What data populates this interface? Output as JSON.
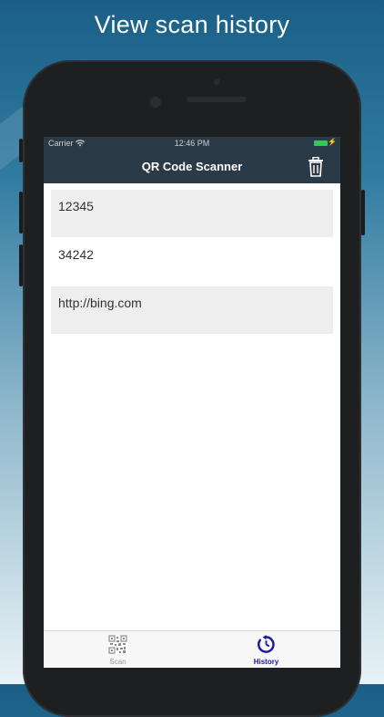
{
  "promo": {
    "headline": "View scan history"
  },
  "status_bar": {
    "carrier": "Carrier",
    "time": "12:46 PM"
  },
  "nav": {
    "title": "QR Code Scanner",
    "delete_icon": "trash-icon"
  },
  "history": {
    "items": [
      {
        "text": "12345",
        "shaded": true
      },
      {
        "text": "34242",
        "shaded": false
      },
      {
        "text": "http://bing.com",
        "shaded": true
      }
    ]
  },
  "tabs": [
    {
      "label": "Scan",
      "icon": "qr-code-icon",
      "selected": false
    },
    {
      "label": "History",
      "icon": "clock-history-icon",
      "selected": true
    }
  ],
  "colors": {
    "nav_background": "#2b3a47",
    "tab_selected": "#1a1aa8",
    "battery": "#34c759",
    "row_shade": "#eeeeee"
  }
}
